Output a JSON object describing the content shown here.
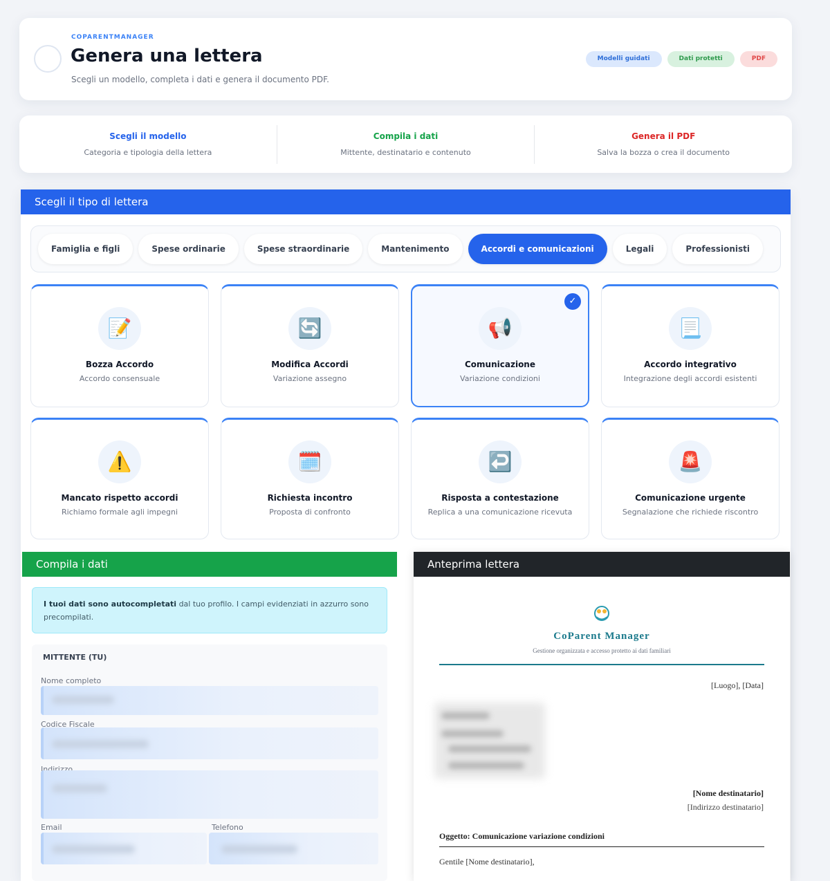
{
  "header": {
    "brand": "COPARENTMANAGER",
    "title": "Genera una lettera",
    "subtitle": "Scegli un modello, completa i dati e genera il documento PDF.",
    "badges": [
      {
        "label": "Modelli guidati",
        "color": "#2f6fd8"
      },
      {
        "label": "Dati protetti",
        "color": "#2f9a4d"
      },
      {
        "label": "PDF",
        "color": "#e04848"
      }
    ]
  },
  "steps": [
    {
      "title": "Scegli il modello",
      "desc": "Categoria e tipologia della lettera",
      "color": "#2563eb"
    },
    {
      "title": "Compila i dati",
      "desc": "Mittente, destinatario e contenuto",
      "color": "#16a34a"
    },
    {
      "title": "Genera il PDF",
      "desc": "Salva la bozza o crea il documento",
      "color": "#dc2626"
    }
  ],
  "type_section": {
    "title": "Scegli il tipo di lettera",
    "tabs": [
      {
        "label": "Famiglia e figli",
        "active": false
      },
      {
        "label": "Spese ordinarie",
        "active": false
      },
      {
        "label": "Spese straordinarie",
        "active": false
      },
      {
        "label": "Mantenimento",
        "active": false
      },
      {
        "label": "Accordi e comunicazioni",
        "active": true
      },
      {
        "label": "Legali",
        "active": false
      },
      {
        "label": "Professionisti",
        "active": false
      }
    ],
    "templates": [
      {
        "icon": "memo-icon",
        "glyph": "📝",
        "title": "Bozza Accordo",
        "desc": "Accordo consensuale",
        "selected": false
      },
      {
        "icon": "refresh-icon",
        "glyph": "🔄",
        "title": "Modifica Accordi",
        "desc": "Variazione assegno",
        "selected": false
      },
      {
        "icon": "megaphone-icon",
        "glyph": "📢",
        "title": "Comunicazione",
        "desc": "Variazione condizioni",
        "selected": true
      },
      {
        "icon": "document-icon",
        "glyph": "📃",
        "title": "Accordo integrativo",
        "desc": "Integrazione degli accordi esistenti",
        "selected": false
      },
      {
        "icon": "warning-icon",
        "glyph": "⚠️",
        "title": "Mancato rispetto accordi",
        "desc": "Richiamo formale agli impegni",
        "selected": false
      },
      {
        "icon": "calendar-icon",
        "glyph": "🗓️",
        "title": "Richiesta incontro",
        "desc": "Proposta di confronto",
        "selected": false
      },
      {
        "icon": "reply-arrow-icon",
        "glyph": "↩️",
        "title": "Risposta a contestazione",
        "desc": "Replica a una comunicazione ricevuta",
        "selected": false
      },
      {
        "icon": "siren-icon",
        "glyph": "🚨",
        "title": "Comunicazione urgente",
        "desc": "Segnalazione che richiede riscontro",
        "selected": false
      }
    ]
  },
  "form": {
    "title": "Compila i dati",
    "info_bold": "I tuoi dati sono autocompletati",
    "info_rest": " dal tuo profilo. I campi evidenziati in azzurro sono precompilati.",
    "sender_title": "MITTENTE (TU)",
    "fields": {
      "name": "Nome completo",
      "tax_code": "Codice Fiscale",
      "address": "Indirizzo",
      "email": "Email",
      "phone": "Telefono"
    }
  },
  "preview": {
    "title": "Anteprima lettera",
    "brand": "CoParent Manager",
    "tagline": "Gestione organizzata e accesso protetto ai dati familiari",
    "place_date": "[Luogo], [Data]",
    "recipient_name": "[Nome destinatario]",
    "recipient_address": "[Indirizzo destinatario]",
    "subject": "Oggetto: Comunicazione variazione condizioni",
    "greeting": "Gentile [Nome destinatario],"
  }
}
